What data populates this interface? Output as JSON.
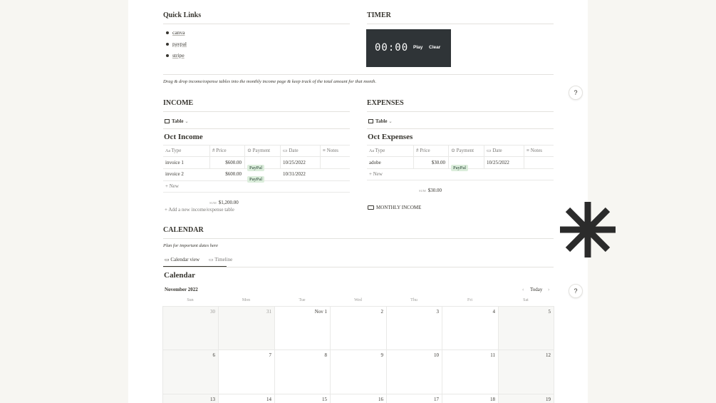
{
  "quick_links": {
    "title": "Quick Links",
    "items": [
      "canva",
      "paypal",
      "stripe"
    ]
  },
  "timer": {
    "title": "TIMER",
    "display": "00:00",
    "play": "Play",
    "clear": "Clear"
  },
  "instructions": "Drag & drop income/expense tables into the monthly income page & keep track of the total amount for that month.",
  "income": {
    "title": "INCOME",
    "view": "Table",
    "table_title": "Oct Income",
    "columns": [
      "Type",
      "Price",
      "Payment",
      "Date",
      "Notes"
    ],
    "rows": [
      {
        "type": "invoice 1",
        "price": "$600.00",
        "payment": "PayPal",
        "date": "10/25/2022"
      },
      {
        "type": "invoice 2",
        "price": "$600.00",
        "payment": "PayPal",
        "date": "10/31/2022"
      }
    ],
    "new": "New",
    "sum_label": "SUM",
    "sum": "$1,200.00",
    "add_table": "Add a new income/expense table"
  },
  "expenses": {
    "title": "EXPENSES",
    "view": "Table",
    "table_title": "Oct Expenses",
    "columns": [
      "Type",
      "Price",
      "Payment",
      "Date",
      "Notes"
    ],
    "rows": [
      {
        "type": "adobe",
        "price": "$30.00",
        "payment": "PayPal",
        "date": "10/25/2022"
      }
    ],
    "new": "New",
    "sum_label": "SUM",
    "sum": "$30.00",
    "monthly_link": "MONTHLY INCOME"
  },
  "calendar": {
    "title": "CALENDAR",
    "subtitle": "Plan for important dates here",
    "tabs": [
      "Calendar view",
      "Timeline"
    ],
    "heading": "Calendar",
    "month": "November 2022",
    "today": "Today",
    "weekdays": [
      "Sun",
      "Mon",
      "Tue",
      "Wed",
      "Thu",
      "Fri",
      "Sat"
    ],
    "weeks": [
      [
        "30",
        "31",
        "Nov 1",
        "2",
        "3",
        "4",
        "5"
      ],
      [
        "6",
        "7",
        "8",
        "9",
        "10",
        "11",
        "12"
      ],
      [
        "13",
        "14",
        "15",
        "16",
        "17",
        "18",
        "19"
      ]
    ]
  },
  "help": "?",
  "colors": {
    "page": "#ffffff",
    "background": "#f7f6f2",
    "timer_bg": "#2f3437",
    "badge_bg": "#dbeddb",
    "asterisk": "#2b2b2b"
  }
}
